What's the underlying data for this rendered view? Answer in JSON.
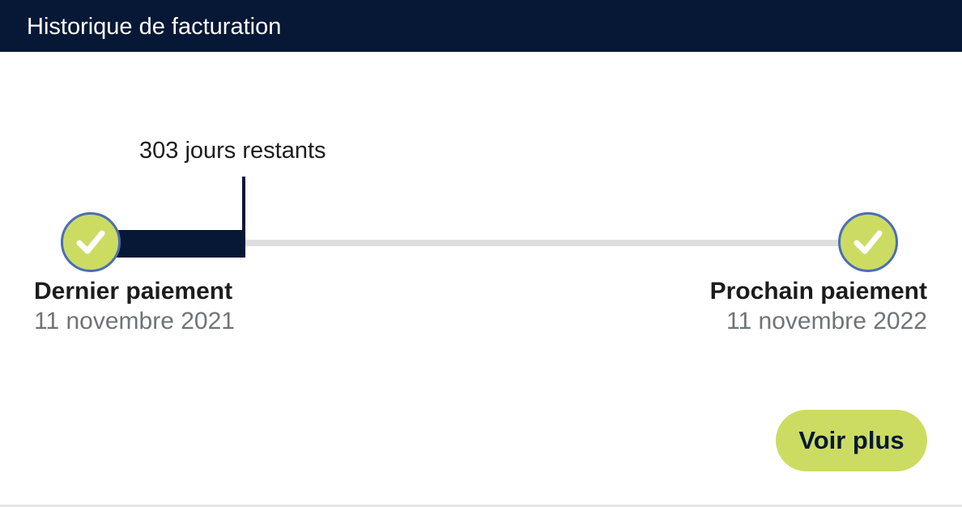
{
  "header": {
    "title": "Historique de facturation"
  },
  "timeline": {
    "remaining_label": "303 jours restants",
    "progress_fraction": 0.17,
    "last_payment": {
      "title": "Dernier paiement",
      "date": "11 novembre 2021",
      "icon": "check-circle-icon"
    },
    "next_payment": {
      "title": "Prochain paiement",
      "date": "11 novembre 2022",
      "icon": "check-circle-icon"
    }
  },
  "actions": {
    "see_more_label": "Voir plus"
  },
  "colors": {
    "header_bg": "#061836",
    "accent": "#ccdc62",
    "progress": "#061836",
    "track": "#dedede",
    "icon_border": "#4b6eb5",
    "muted_text": "#6e7479"
  }
}
